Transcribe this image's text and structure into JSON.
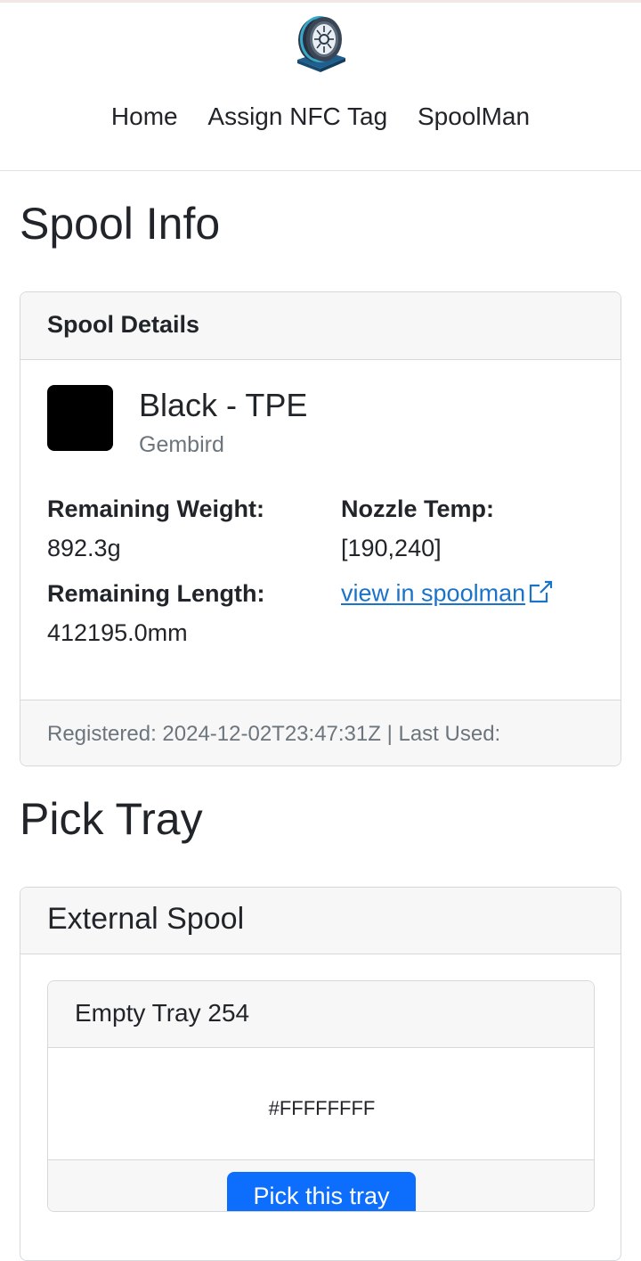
{
  "nav": {
    "items": [
      "Home",
      "Assign NFC Tag",
      "SpoolMan"
    ]
  },
  "icons": {
    "logo": "filament-spool-icon",
    "external_link": "external-link-icon"
  },
  "spool_info": {
    "title": "Spool Info",
    "card_header": "Spool Details",
    "color_hex": "#000000",
    "name": "Black - TPE",
    "vendor": "Gembird",
    "remaining_weight_label": "Remaining Weight:",
    "remaining_weight": "892.3g",
    "remaining_length_label": "Remaining Length:",
    "remaining_length": "412195.0mm",
    "nozzle_temp_label": "Nozzle Temp:",
    "nozzle_temp": "[190,240]",
    "spoolman_link": "view in spoolman",
    "footer": "Registered: 2024-12-02T23:47:31Z | Last Used:"
  },
  "pick_tray": {
    "title": "Pick Tray",
    "group_header": "External Spool",
    "tray_header": "Empty Tray 254",
    "tray_color": "#FFFFFFFF",
    "button_label": "Pick this tray"
  },
  "colors": {
    "accent": "#0d6efd",
    "link": "#1a73c8"
  }
}
